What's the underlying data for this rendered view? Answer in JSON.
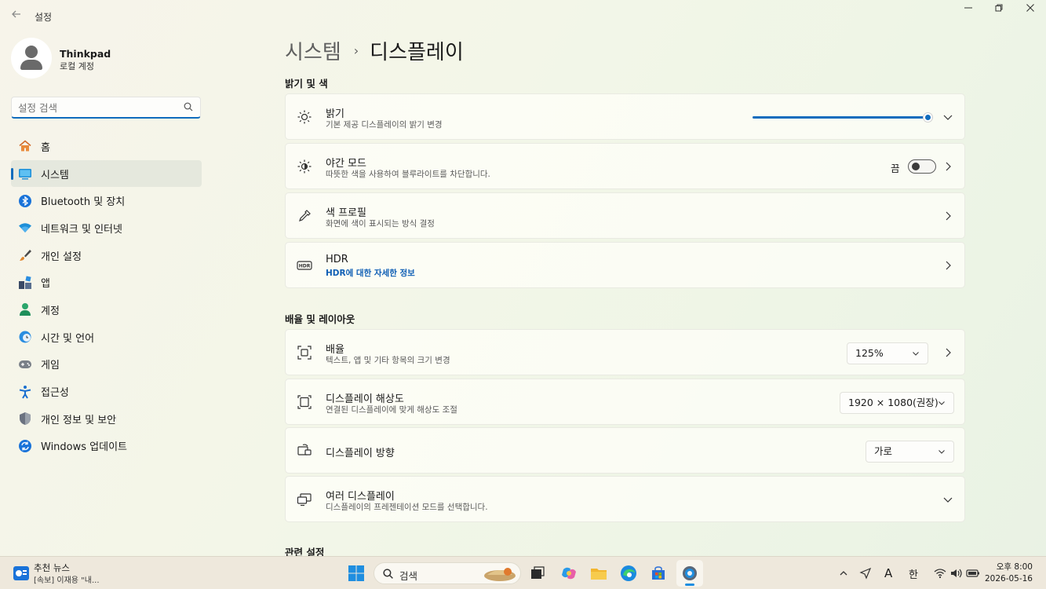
{
  "window": {
    "app_title": "설정",
    "controls": {
      "minimize": "—",
      "maximize": "⧉",
      "close": "✕"
    }
  },
  "profile": {
    "name": "Thinkpad",
    "account": "로컬 계정"
  },
  "search": {
    "placeholder": "설정 검색"
  },
  "sidebar": {
    "items": [
      {
        "label": "홈",
        "icon": "home-icon"
      },
      {
        "label": "시스템",
        "icon": "system-icon",
        "active": true
      },
      {
        "label": "Bluetooth 및 장치",
        "icon": "bluetooth-icon"
      },
      {
        "label": "네트워크 및 인터넷",
        "icon": "wifi-icon"
      },
      {
        "label": "개인 설정",
        "icon": "brush-icon"
      },
      {
        "label": "앱",
        "icon": "apps-icon"
      },
      {
        "label": "계정",
        "icon": "account-icon"
      },
      {
        "label": "시간 및 언어",
        "icon": "globe-clock-icon"
      },
      {
        "label": "게임",
        "icon": "gamepad-icon"
      },
      {
        "label": "접근성",
        "icon": "accessibility-icon"
      },
      {
        "label": "개인 정보 및 보안",
        "icon": "shield-icon"
      },
      {
        "label": "Windows 업데이트",
        "icon": "update-icon"
      }
    ]
  },
  "breadcrumb": {
    "parent": "시스템",
    "separator": "›",
    "current": "디스플레이"
  },
  "sections": {
    "brightness_color": "밝기 및 색",
    "scale_layout": "배율 및 레이아웃",
    "related": "관련 설정"
  },
  "cards": {
    "brightness": {
      "title": "밝기",
      "subtitle": "기본 제공 디스플레이의 밝기 변경",
      "value_percent": 100
    },
    "night_mode": {
      "title": "야간 모드",
      "subtitle": "따뜻한 색을 사용하여 블루라이트를 차단합니다.",
      "state_label": "끔",
      "on": false
    },
    "color_profile": {
      "title": "색 프로필",
      "subtitle": "화면에 색이 표시되는 방식 결정"
    },
    "hdr": {
      "title": "HDR",
      "link": "HDR에 대한 자세한 정보"
    },
    "scale": {
      "title": "배율",
      "subtitle": "텍스트, 앱 및 기타 항목의 크기 변경",
      "value": "125%"
    },
    "resolution": {
      "title": "디스플레이 해상도",
      "subtitle": "연결된 디스플레이에 맞게 해상도 조절",
      "value": "1920 × 1080(권장)"
    },
    "orientation": {
      "title": "디스플레이 방향",
      "value": "가로"
    },
    "multi_display": {
      "title": "여러 디스플레이",
      "subtitle": "디스플레이의 프레젠테이션 모드를 선택합니다."
    }
  },
  "taskbar": {
    "news_title": "추천 뉴스",
    "news_sub": "[속보] 이재용 \"내...",
    "search_label": "검색",
    "ime_a": "A",
    "ime_lang": "한",
    "time": "오후 8:00",
    "date": "2026-05-16"
  },
  "colors": {
    "accent": "#0f6cbd",
    "link": "#0f5fb5"
  }
}
